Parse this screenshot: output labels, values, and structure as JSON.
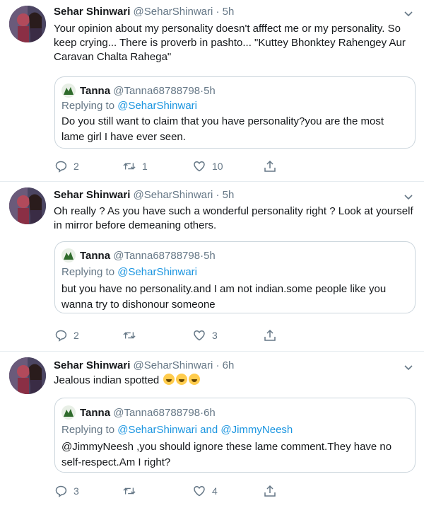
{
  "tweets": [
    {
      "author": {
        "name": "Sehar Shinwari",
        "handle": "@SeharShinwari",
        "time": "5h"
      },
      "text": "Your opinion about my personality doesn't afffect me or my personality. So keep crying... There is proverb in pashto... \"Kuttey Bhonktey Rahengey Aur Caravan Chalta Rahega\"",
      "quote": {
        "author": {
          "name": "Tanna",
          "handle": "@Tanna68788798",
          "time": "5h"
        },
        "replying_prefix": "Replying to ",
        "replying_to": "@SeharShinwari",
        "text": "Do you still want to claim that  you have personality?you are the most lame girl I have ever seen."
      },
      "actions": {
        "replies": "2",
        "retweets": "1",
        "likes": "10"
      }
    },
    {
      "author": {
        "name": "Sehar Shinwari",
        "handle": "@SeharShinwari",
        "time": "5h"
      },
      "text": "Oh really ? As you have such a wonderful personality right ?  Look at yourself in mirror before demeaning others.",
      "quote": {
        "author": {
          "name": "Tanna",
          "handle": "@Tanna68788798",
          "time": "5h"
        },
        "replying_prefix": "Replying to ",
        "replying_to": "@SeharShinwari",
        "text": "but you have no personality.and I am not indian.some people like you wanna try to dishonour someone"
      },
      "actions": {
        "replies": "2",
        "retweets": "",
        "likes": "3"
      }
    },
    {
      "author": {
        "name": "Sehar Shinwari",
        "handle": "@SeharShinwari",
        "time": "6h"
      },
      "text": "Jealous indian spotted",
      "emoji_count_label": "grinning-face-emoji",
      "quote": {
        "author": {
          "name": "Tanna",
          "handle": "@Tanna68788798",
          "time": "6h"
        },
        "replying_prefix": "Replying to ",
        "replying_to": "@SeharShinwari and @JimmyNeesh",
        "text": "@JimmyNeesh ,you should ignore these lame comment.They have no self-respect.Am I right?"
      },
      "actions": {
        "replies": "3",
        "retweets": "",
        "likes": "4"
      }
    }
  ],
  "separator": " · ",
  "colors": {
    "name": "#14171a",
    "meta": "#657786",
    "link": "#1b95e0",
    "border": "#ccd6dd",
    "divider": "#e6ecf0"
  }
}
